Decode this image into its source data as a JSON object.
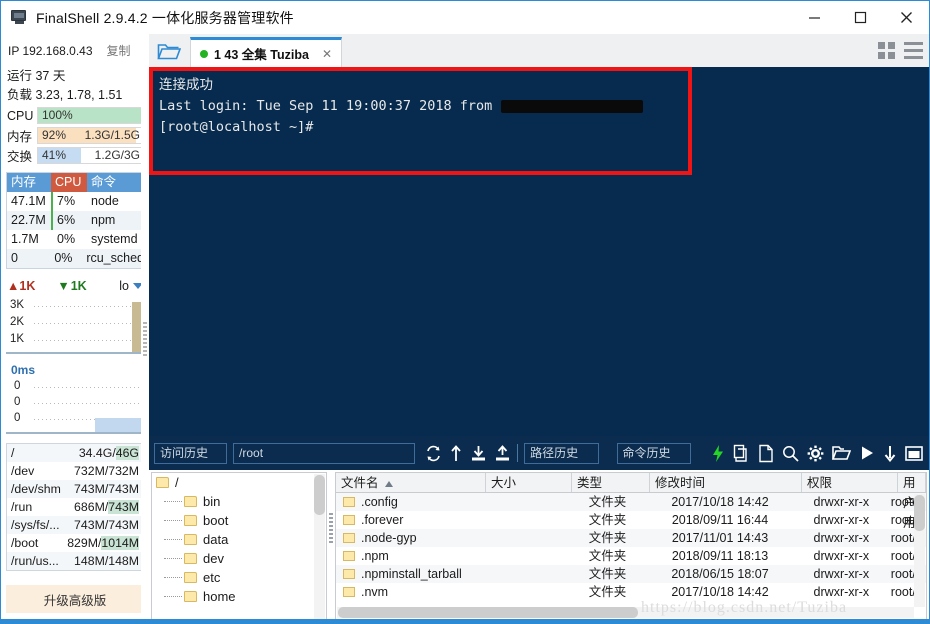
{
  "window": {
    "title": "FinalShell 2.9.4.2 一体化服务器管理软件",
    "app_icon": "monitor-icon",
    "minimize": "—",
    "maximize": "□",
    "close": "✕"
  },
  "tabbar": {
    "ip_label": "IP 192.168.0.43",
    "copy_label": "复制",
    "folder_icon": "open-folder-icon",
    "tab": {
      "label": "1 43 全集 Tuziba",
      "status_dot": "#22b222",
      "close": "✕"
    },
    "grid_icon": "grid-view-icon",
    "menu_icon": "hamburger-menu-icon"
  },
  "sidebar": {
    "uptime": "运行 37 天",
    "load": "负载 3.23, 1.78, 1.51",
    "meters": [
      {
        "label": "CPU",
        "pct": "100%",
        "amount": "",
        "fill_pct": 100,
        "color": "#b9e3c6"
      },
      {
        "label": "内存",
        "pct": "92%",
        "amount": "1.3G/1.5G",
        "fill_pct": 92,
        "color": "#fbe0c0"
      },
      {
        "label": "交换",
        "pct": "41%",
        "amount": "1.2G/3G",
        "fill_pct": 41,
        "color": "#c6dcf2"
      }
    ],
    "proc_headers": [
      "内存",
      "CPU",
      "命令"
    ],
    "procs": [
      {
        "mem": "47.1M",
        "cpu": "7%",
        "cmd": "node"
      },
      {
        "mem": "22.7M",
        "cpu": "6%",
        "cmd": "npm"
      },
      {
        "mem": "1.7M",
        "cpu": "0%",
        "cmd": "systemd"
      },
      {
        "mem": "0",
        "cpu": "0%",
        "cmd": "rcu_sched"
      }
    ],
    "net": {
      "upload": "1K",
      "download": "1K",
      "interface": "lo",
      "up_icon": "arrow-up-icon",
      "down_icon": "arrow-down-icon",
      "dropdown_icon": "chevron-down-icon"
    },
    "net_ticks": [
      "3K",
      "2K",
      "1K"
    ],
    "latency_label": "0ms",
    "latency_ticks": [
      "0",
      "0",
      "0"
    ],
    "disks": [
      {
        "path": "/",
        "used": "34.4G",
        "total": "46G"
      },
      {
        "path": "/dev",
        "used": "732M",
        "total": "732M"
      },
      {
        "path": "/dev/shm",
        "used": "743M",
        "total": "743M"
      },
      {
        "path": "/run",
        "used": "686M",
        "total": "743M"
      },
      {
        "path": "/sys/fs/...",
        "used": "743M",
        "total": "743M"
      },
      {
        "path": "/boot",
        "used": "829M",
        "total": "1014M"
      },
      {
        "path": "/run/us...",
        "used": "148M",
        "total": "148M"
      }
    ],
    "upgrade_label": "升级高级版"
  },
  "terminal": {
    "line1": "连接成功",
    "line2_prefix": "Last login: Tue Sep 11 19:00:37 2018 from ",
    "line2_redacted": "redacted-host-block",
    "line3": "[root@localhost ~]#",
    "highlight_color": "#f01414",
    "background": "#062b4e"
  },
  "xferbar": {
    "history_placeholder": "访问历史",
    "path_value": "/root",
    "path_history_placeholder": "路径历史",
    "cmd_history_placeholder": "命令历史",
    "icons": [
      "refresh-icon",
      "upload-arrow-icon",
      "download-icon",
      "upload-icon",
      "lightning-icon",
      "copy-icon",
      "paste-icon",
      "search-icon",
      "gear-icon",
      "folder-open-icon",
      "play-icon",
      "download-down-icon",
      "window-icon"
    ]
  },
  "tree": {
    "root": "/",
    "nodes": [
      "bin",
      "boot",
      "data",
      "dev",
      "etc",
      "home"
    ]
  },
  "filelist": {
    "headers": [
      "文件名",
      "大小",
      "类型",
      "修改时间",
      "权限",
      "用户/用"
    ],
    "sort_column": "文件名",
    "rows": [
      {
        "name": ".config",
        "size": "",
        "type": "文件夹",
        "mtime": "2017/10/18 14:42",
        "perm": "drwxr-xr-x",
        "owner": "root/r"
      },
      {
        "name": ".forever",
        "size": "",
        "type": "文件夹",
        "mtime": "2018/09/11 16:44",
        "perm": "drwxr-xr-x",
        "owner": "root/r"
      },
      {
        "name": ".node-gyp",
        "size": "",
        "type": "文件夹",
        "mtime": "2017/11/01 14:43",
        "perm": "drwxr-xr-x",
        "owner": "root/r"
      },
      {
        "name": ".npm",
        "size": "",
        "type": "文件夹",
        "mtime": "2018/09/11 18:13",
        "perm": "drwxr-xr-x",
        "owner": "root/r"
      },
      {
        "name": ".npminstall_tarball",
        "size": "",
        "type": "文件夹",
        "mtime": "2018/06/15 18:07",
        "perm": "drwxr-xr-x",
        "owner": "root/r"
      },
      {
        "name": ".nvm",
        "size": "",
        "type": "文件夹",
        "mtime": "2017/10/18 14:42",
        "perm": "drwxr-xr-x",
        "owner": "root/r"
      }
    ]
  },
  "watermark": "https://blog.csdn.net/Tuziba"
}
